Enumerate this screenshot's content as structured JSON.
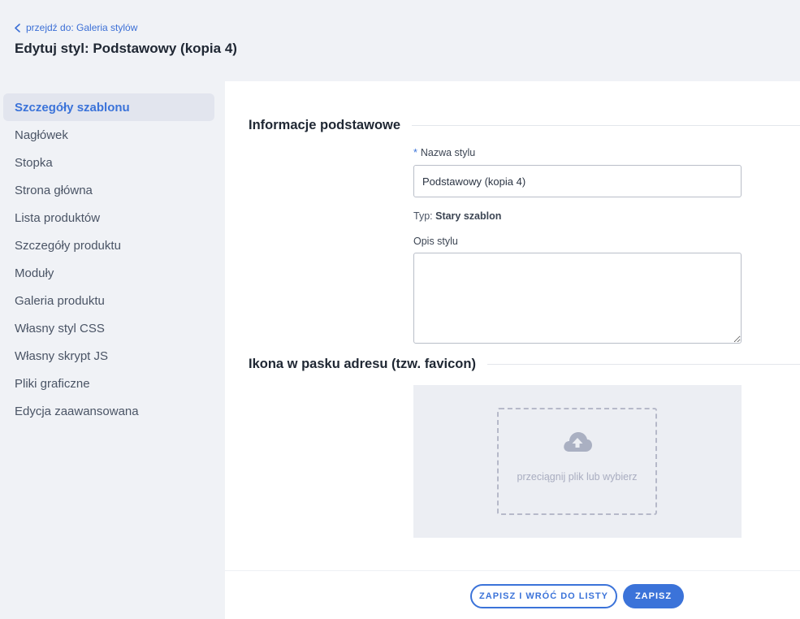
{
  "header": {
    "back_link": "przejdź do: Galeria stylów",
    "title": "Edytuj styl: Podstawowy (kopia 4)"
  },
  "sidebar": {
    "items": [
      {
        "label": "Szczegóły szablonu",
        "active": true
      },
      {
        "label": "Nagłówek"
      },
      {
        "label": "Stopka"
      },
      {
        "label": "Strona główna"
      },
      {
        "label": "Lista produktów"
      },
      {
        "label": "Szczegóły produktu"
      },
      {
        "label": "Moduły"
      },
      {
        "label": "Galeria produktu"
      },
      {
        "label": "Własny styl CSS"
      },
      {
        "label": "Własny skrypt JS"
      },
      {
        "label": "Pliki graficzne"
      },
      {
        "label": "Edycja zaawansowana"
      }
    ]
  },
  "form": {
    "section_basic": "Informacje podstawowe",
    "name_required_mark": "*",
    "name_label": "Nazwa stylu",
    "name_value": "Podstawowy (kopia 4)",
    "type_prefix": "Typ:",
    "type_value": "Stary szablon",
    "desc_label": "Opis stylu",
    "desc_value": "",
    "section_favicon": "Ikona w pasku adresu (tzw. favicon)",
    "upload_text": "przeciągnij plik lub wybierz"
  },
  "footer": {
    "save_back_label": "ZAPISZ I WRÓĆ DO LISTY",
    "save_label": "ZAPISZ"
  },
  "colors": {
    "accent": "#3b73d9",
    "background": "#f0f2f6",
    "sidebar_active_bg": "#e2e5ee",
    "upload_bg": "#eceef3"
  },
  "icons": {
    "back": "chevron-left-icon",
    "upload": "cloud-upload-icon"
  }
}
